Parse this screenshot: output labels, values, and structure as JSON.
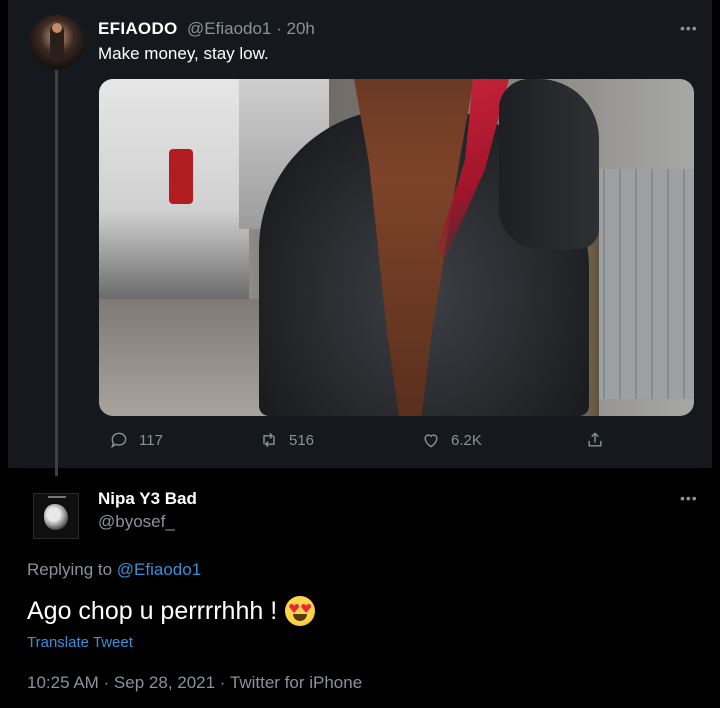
{
  "parent_tweet": {
    "display_name": "EFIAODO",
    "handle": "@Efiaodo1",
    "separator": " · ",
    "time_ago": "20h",
    "text": "Make money, stay low.",
    "more_icon": "more-horizontal-icon",
    "stats": {
      "replies": "117",
      "retweets": "516",
      "likes": "6.2K"
    }
  },
  "reply_tweet": {
    "display_name": "Nipa Y3 Bad",
    "handle": "@byosef_",
    "more_icon": "more-horizontal-icon",
    "replying_prefix": "Replying to ",
    "replying_to": "@Efiaodo1",
    "text": "Ago chop u perrrrhhh !",
    "emoji": "heart-eyes-emoji",
    "translate_label": "Translate Tweet",
    "timestamp": "10:25 AM · Sep 28, 2021 · Twitter for iPhone"
  },
  "colors": {
    "background": "#000000",
    "parent_bg": "#15181c",
    "muted_text": "#8b9298",
    "link": "#3b8fd6",
    "thread_line": "#3d4145"
  }
}
